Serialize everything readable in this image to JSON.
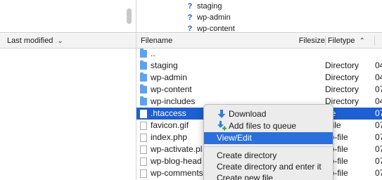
{
  "tree": {
    "items": [
      {
        "label": "staging",
        "icon": "question-icon"
      },
      {
        "label": "wp-admin",
        "icon": "question-icon"
      },
      {
        "label": "wp-content",
        "icon": "question-icon"
      }
    ]
  },
  "columns": {
    "last_modified": "Last modified",
    "filename": "Filename",
    "filesize": "Filesize",
    "filetype": "Filetype"
  },
  "files": [
    {
      "name": "..",
      "type": "",
      "date": "",
      "kind": "folder"
    },
    {
      "name": "staging",
      "type": "Directory",
      "date": "04",
      "kind": "folder"
    },
    {
      "name": "wp-admin",
      "type": "Directory",
      "date": "04",
      "kind": "folder"
    },
    {
      "name": "wp-content",
      "type": "Directory",
      "date": "07",
      "kind": "folder"
    },
    {
      "name": "wp-includes",
      "type": "Directory",
      "date": "04",
      "kind": "folder"
    },
    {
      "name": ".htaccess",
      "type": "file",
      "date": "07",
      "kind": "file",
      "selected": true
    },
    {
      "name": "favicon.gif",
      "type": "f-file",
      "date": "07",
      "kind": "file"
    },
    {
      "name": "index.php",
      "type": "hp-file",
      "date": "07",
      "kind": "file"
    },
    {
      "name": "wp-activate.pl",
      "type": "hp-file",
      "date": "07",
      "kind": "file"
    },
    {
      "name": "wp-blog-head",
      "type": "hp-file",
      "date": "07",
      "kind": "file"
    },
    {
      "name": "wp-comments",
      "type": "hp-file",
      "date": "07",
      "kind": "file"
    }
  ],
  "context_menu": {
    "download": "Download",
    "add_to_queue": "Add files to queue",
    "view_edit": "View/Edit",
    "create_directory": "Create directory",
    "create_directory_enter": "Create directory and enter it",
    "create_new_file": "Create new file"
  },
  "colors": {
    "selection": "#1e5fd1",
    "menu_highlight": "#2a6fdb",
    "folder": "#5ba3f0"
  }
}
